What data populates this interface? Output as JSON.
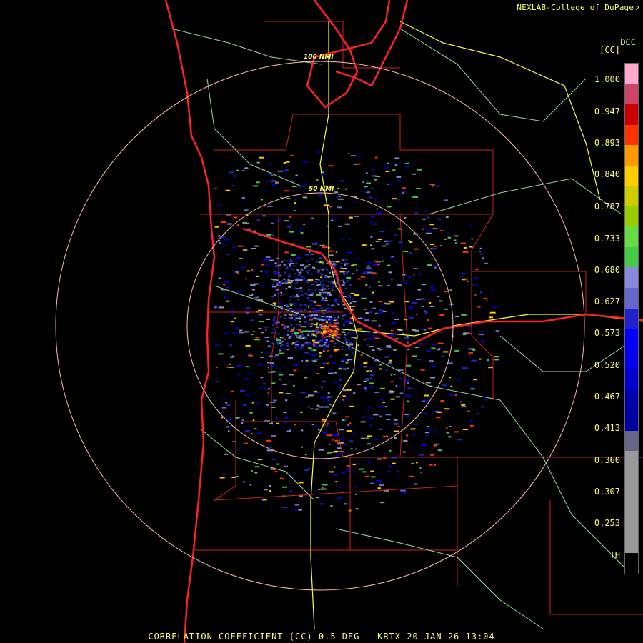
{
  "header": {
    "credit": "NEXLAB-College of DuPage",
    "credit_icon": "external-link-icon",
    "product_code": "DCC",
    "unit": "[CC]"
  },
  "rings": {
    "inner_label": "50 NMI",
    "outer_label": "100 NMI"
  },
  "colorbar": {
    "ticks": [
      "1.000",
      "0.947",
      "0.893",
      "0.840",
      "0.787",
      "0.733",
      "0.680",
      "0.627",
      "0.573",
      "0.520",
      "0.467",
      "0.413",
      "0.360",
      "0.307",
      "0.253",
      "TH"
    ],
    "colors": [
      "#ffaacc",
      "#cc4466",
      "#cc0000",
      "#ff3300",
      "#ff9900",
      "#ffcc00",
      "#cccc00",
      "#99cc00",
      "#66dd44",
      "#44cc44",
      "#8888dd",
      "#6666cc",
      "#2222cc",
      "#0000ff",
      "#0000ee",
      "#0000cc",
      "#0000aa",
      "#0000a0",
      "#666688",
      "#999999",
      "#999999",
      "#999999",
      "#999999",
      "#999999",
      "#000000"
    ],
    "accent": "#ffff66"
  },
  "footer": {
    "caption": "CORRELATION COEFFICIENT (CC) 0.5 DEG - KRTX 20 JAN 26 13:04"
  },
  "colors": {
    "coast": "#ff2222",
    "borders": "#cc2222",
    "highways": "#ffff33",
    "rivers": "#99dd99",
    "rings": "#ffbbaa"
  }
}
